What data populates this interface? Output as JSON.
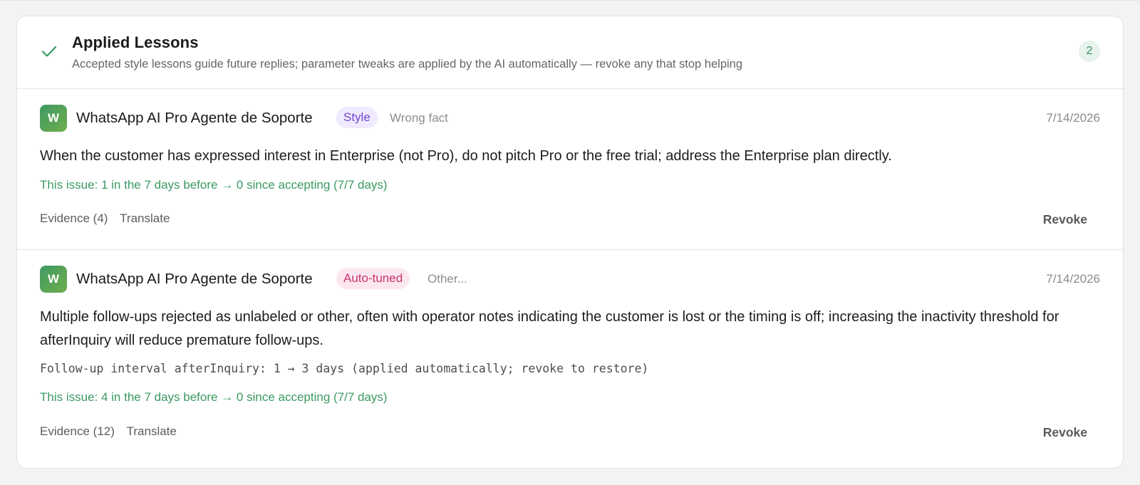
{
  "panel": {
    "title": "Applied Lessons",
    "subtitle": "Accepted style lessons guide future replies; parameter tweaks are applied by the AI automatically — revoke any that stop helping",
    "count": "2",
    "accent_color": "#3a9a62"
  },
  "lessons": [
    {
      "avatar_letter": "W",
      "agent_name": "WhatsApp AI Pro Agente de Soporte",
      "tag": "Style",
      "tag_color": "#7247d3",
      "reason": "Wrong fact",
      "date": "7/14/2026",
      "text": "When the customer has expressed interest in Enterprise (not Pro), do not pitch Pro or the free trial; address the Enterprise plan directly.",
      "impact": "This issue: 1 in the 7 days before → 0 since accepting (7/7 days)",
      "evidence_label": "Evidence (4)",
      "translate_label": "Translate",
      "revoke_label": "Revoke"
    },
    {
      "avatar_letter": "W",
      "agent_name": "WhatsApp AI Pro Agente de Soporte",
      "tag": "Auto-tuned",
      "tag_color": "#c83470",
      "reason": "Other...",
      "date": "7/14/2026",
      "text": "Multiple follow-ups rejected as unlabeled or other, often with operator notes indicating the customer is lost or the timing is off; increasing the inactivity threshold for afterInquiry will reduce premature follow-ups.",
      "param_change": "Follow-up interval afterInquiry: 1 → 3 days (applied automatically; revoke to restore)",
      "impact": "This issue: 4 in the 7 days before → 0 since accepting (7/7 days)",
      "evidence_label": "Evidence (12)",
      "translate_label": "Translate",
      "revoke_label": "Revoke"
    }
  ]
}
